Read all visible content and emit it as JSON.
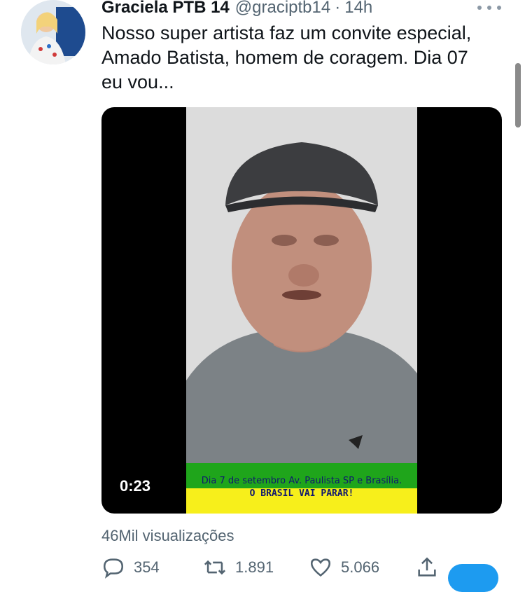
{
  "author": {
    "name": "Graciela PTB 14",
    "handle": "@graciptb14",
    "separator": "·",
    "time": "14h"
  },
  "tweet": {
    "text": "Nosso super artista faz um convite especial, Amado Batista, homem de coragem. Dia 07 eu vou..."
  },
  "video": {
    "duration": "0:23",
    "caption_line1": "Dia 7 de setembro Av. Paulista SP e Brasília.",
    "caption_line2": "O BRASIL VAI PARAR!"
  },
  "stats": {
    "views": "46Mil visualizações",
    "replies": "354",
    "retweets": "1.891",
    "likes": "5.066"
  },
  "icons": {
    "more": "more-icon",
    "reply": "reply-icon",
    "retweet": "retweet-icon",
    "like": "heart-icon",
    "share": "share-icon"
  },
  "colors": {
    "secondary_text": "#536471",
    "banner_green": "#1fa51b",
    "banner_yellow": "#f7ef1b",
    "accent": "#1d9bf0"
  }
}
